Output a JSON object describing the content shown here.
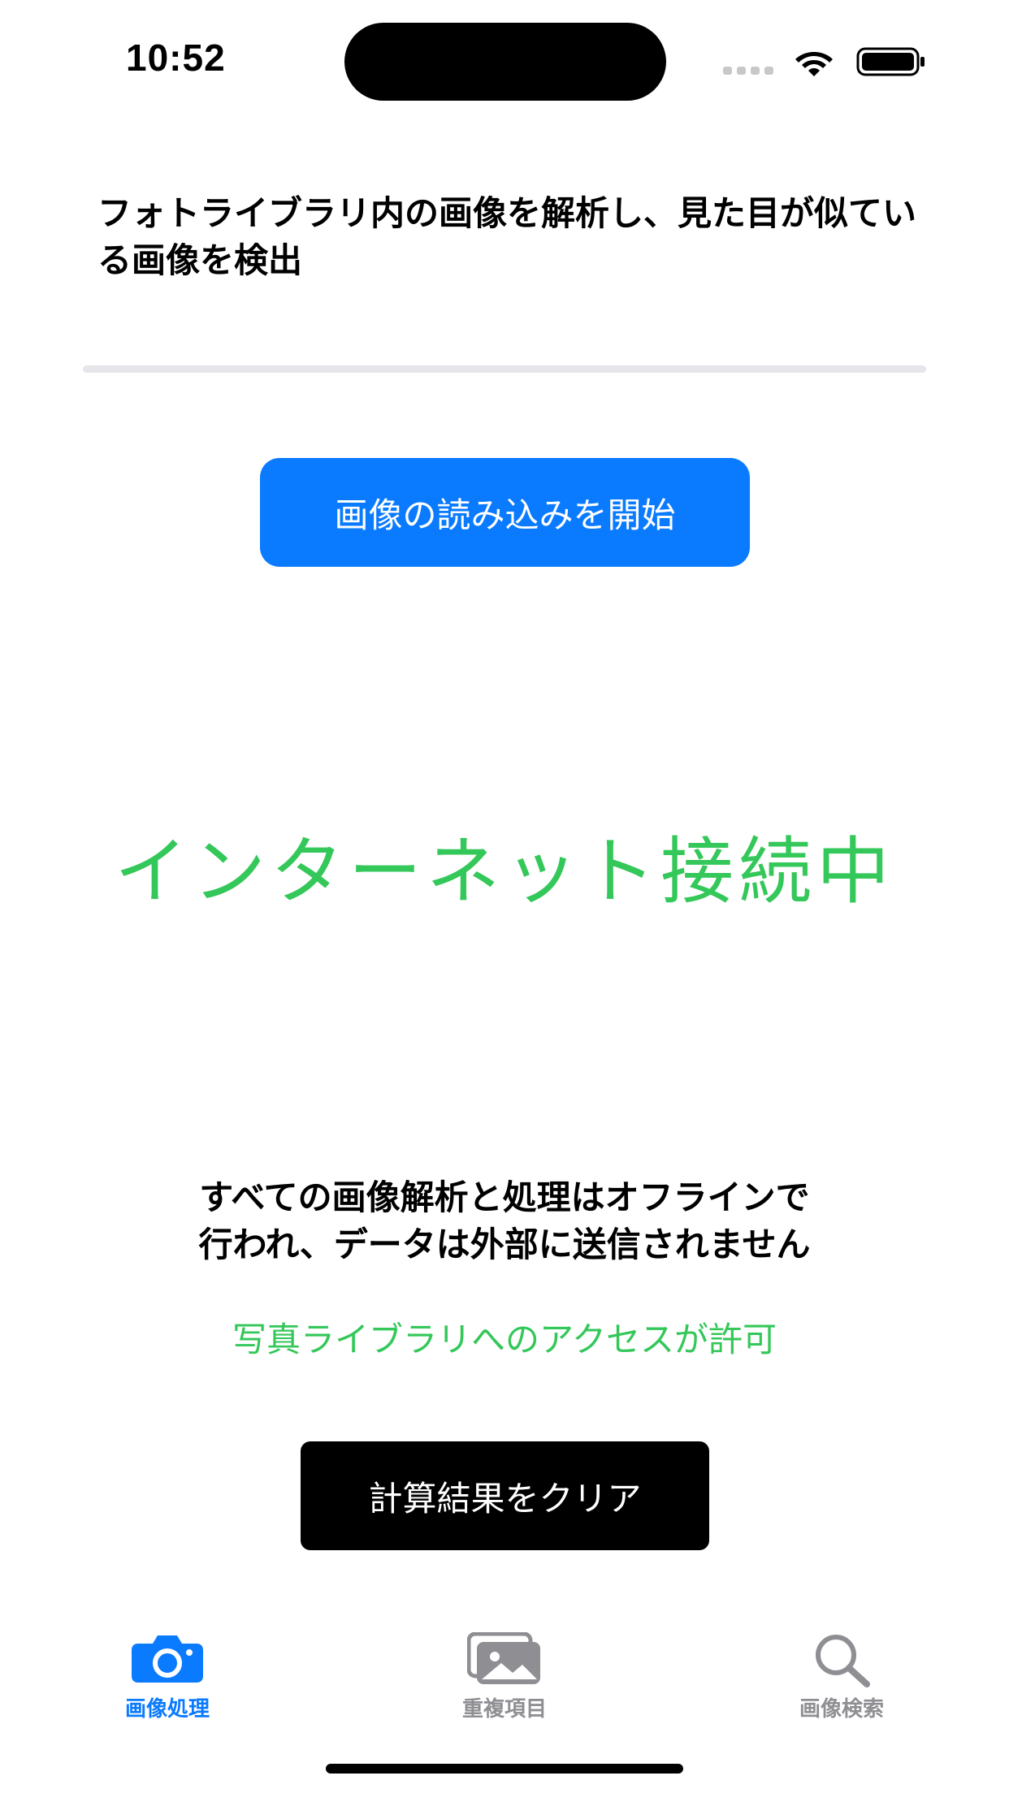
{
  "status_bar": {
    "time": "10:52"
  },
  "main": {
    "headline": "フォトライブラリ内の画像を解析し、見た目が似ている画像を検出",
    "progress": 0,
    "start_button_label": "画像の読み込みを開始",
    "network_status": "インターネット接続中",
    "notice_lines": [
      "すべての画像解析と処理はオフラインで",
      "行われ、データは外部に送信されません"
    ],
    "access_status": "写真ライブラリへのアクセスが許可",
    "clear_button_label": "計算結果をクリア"
  },
  "tab_bar": {
    "items": [
      {
        "label": "画像処理",
        "icon": "camera-icon",
        "active": true
      },
      {
        "label": "重複項目",
        "icon": "photos-icon",
        "active": false
      },
      {
        "label": "画像検索",
        "icon": "magnifier-icon",
        "active": false
      }
    ]
  },
  "colors": {
    "accent": "#0a7aff",
    "success": "#34c759",
    "inactive": "#8e8e93"
  }
}
